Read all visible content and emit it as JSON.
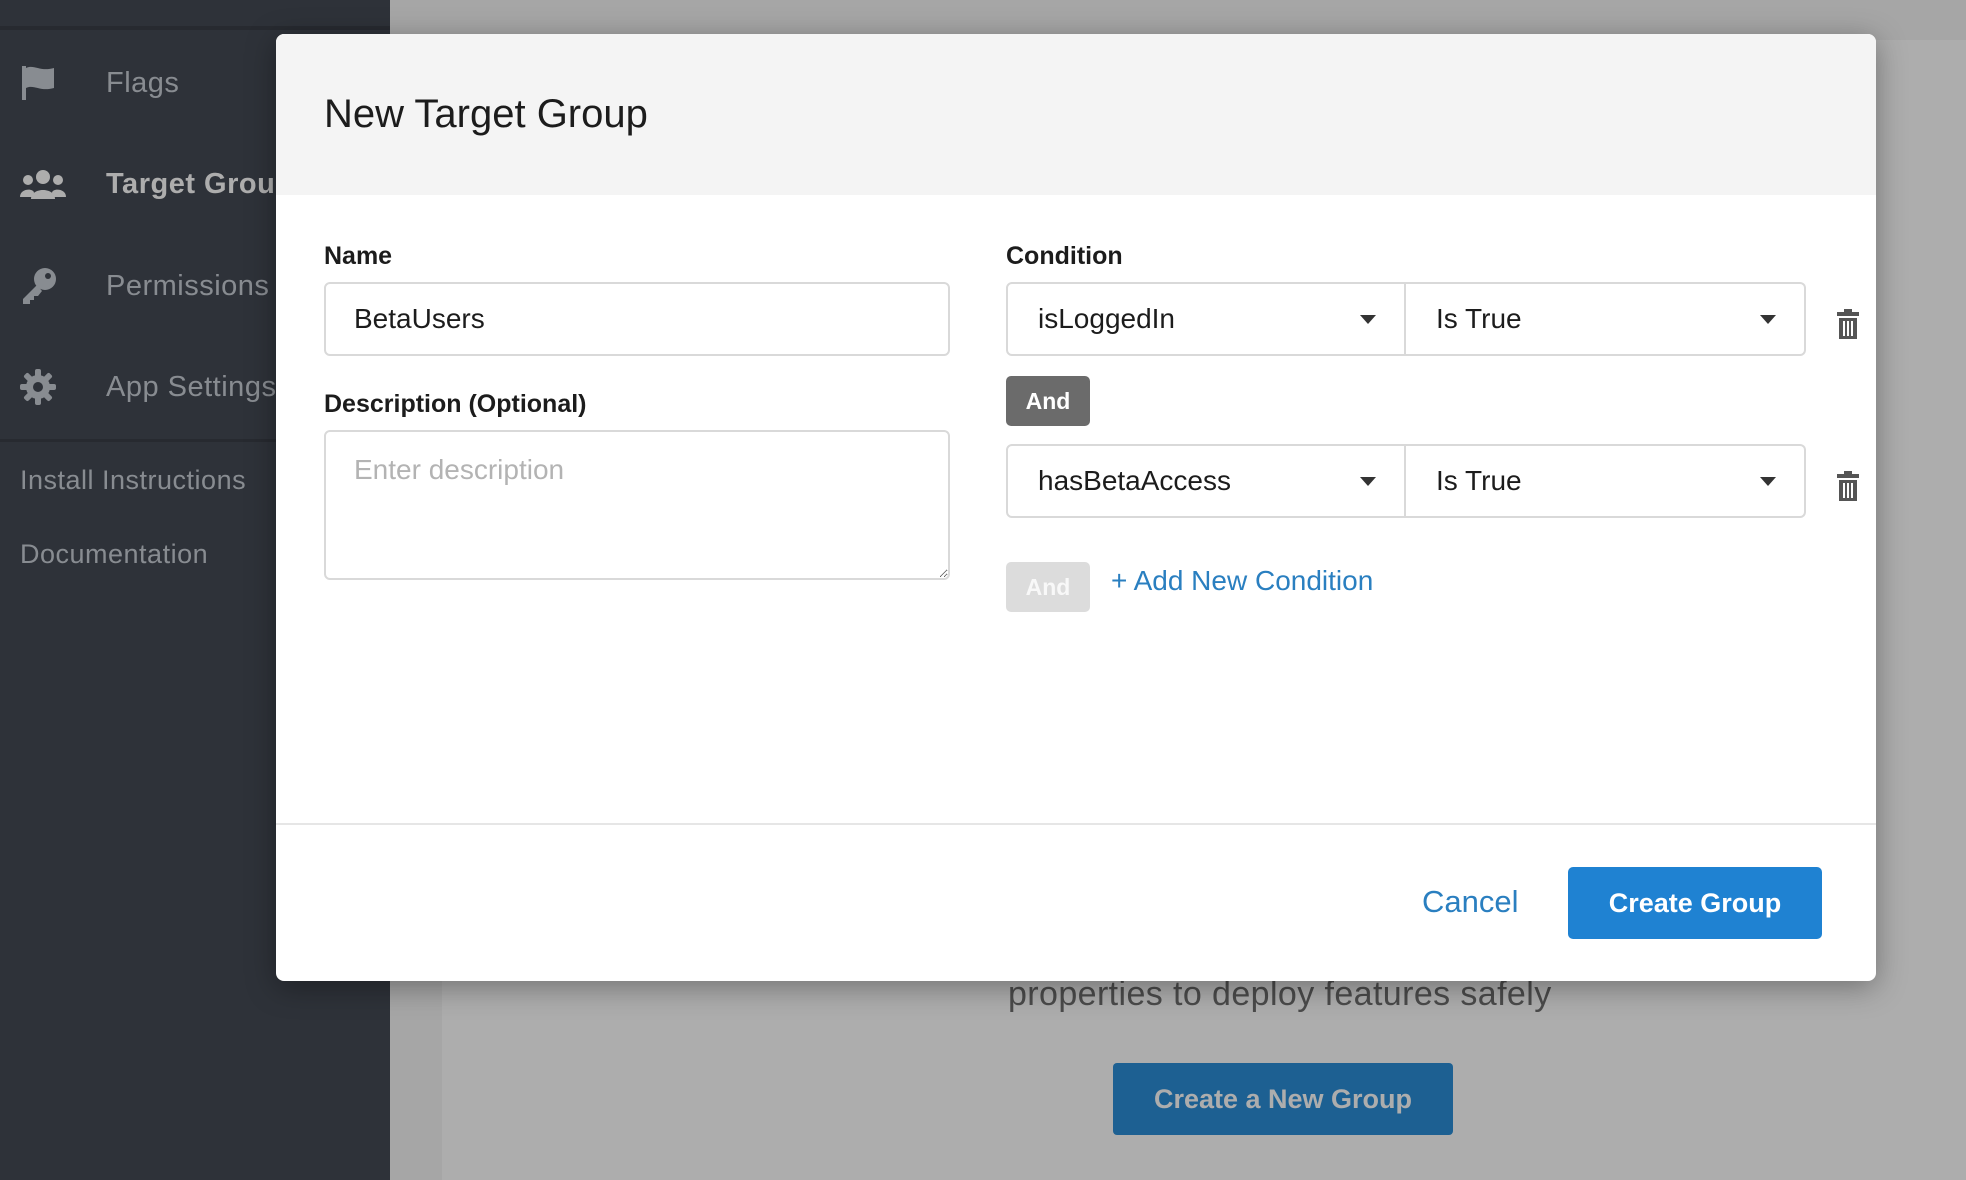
{
  "sidebar": {
    "items": [
      {
        "label": "Flags",
        "icon": "flag-icon"
      },
      {
        "label": "Target Groups",
        "icon": "users-icon"
      },
      {
        "label": "Permissions",
        "icon": "key-icon"
      },
      {
        "label": "App Settings",
        "icon": "gear-icon"
      }
    ],
    "links": [
      "Install Instructions",
      "Documentation"
    ]
  },
  "background": {
    "text": "properties to deploy features safely",
    "button_label": "Create a New Group"
  },
  "modal": {
    "title": "New Target Group",
    "name_label": "Name",
    "name_value": "BetaUsers",
    "description_label": "Description (Optional)",
    "description_placeholder": "Enter description",
    "condition_label": "Condition",
    "conditions": [
      {
        "property": "isLoggedIn",
        "operator": "Is True"
      },
      {
        "property": "hasBetaAccess",
        "operator": "Is True"
      }
    ],
    "conjunction": "And",
    "add_condition_label": "+ Add New Condition",
    "cancel_label": "Cancel",
    "create_label": "Create Group"
  },
  "colors": {
    "accent": "#1f82d2",
    "link": "#2a7fc0",
    "sidebar": "#444a54"
  }
}
